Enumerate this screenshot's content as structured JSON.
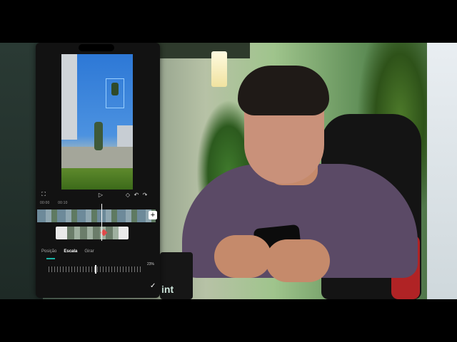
{
  "editor": {
    "tabs": [
      {
        "label": "Posição",
        "active": false
      },
      {
        "label": "Escala",
        "active": true
      },
      {
        "label": "Girar",
        "active": false
      }
    ],
    "scale_value": "23%",
    "time": {
      "current": "00:00",
      "duration": "00:10"
    },
    "icons": [
      "fullscreen-icon",
      "play-icon",
      "keyframe-icon",
      "undo-icon",
      "redo-icon",
      "add-icon",
      "confirm-check-icon"
    ],
    "accent_color": "#19b5a6"
  },
  "mug": {
    "brand_text": "int"
  }
}
